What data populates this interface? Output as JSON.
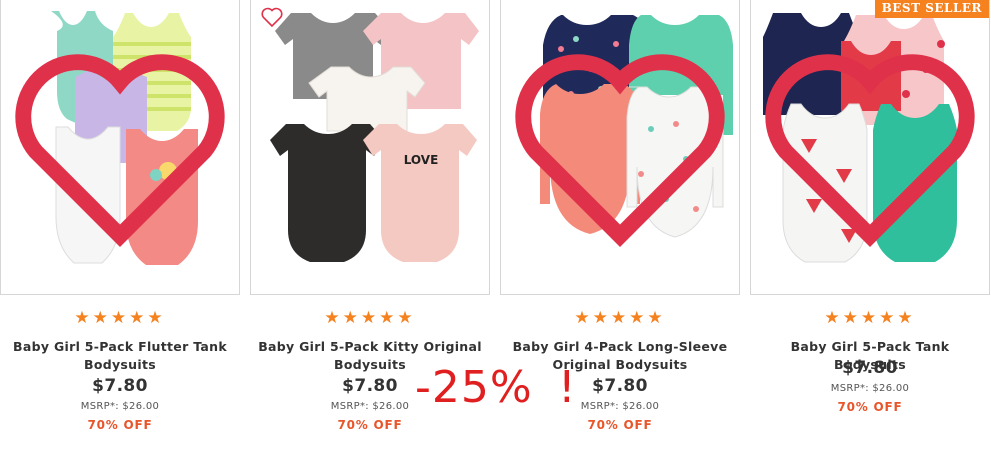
{
  "products": [
    {
      "name": "Baby Girl 5-Pack Flutter Tank Bodysuits",
      "rating": 5,
      "price": "$7.80",
      "msrp": "MSRP*: $26.00",
      "discount": "70% OFF",
      "badge": "",
      "image": "flutter-tank-bodysuits-pack"
    },
    {
      "name": "Baby Girl 5-Pack Kitty Original Bodysuits",
      "rating": 5,
      "price": "$7.80",
      "msrp": "MSRP*: $26.00",
      "discount": "70% OFF",
      "badge": "",
      "image": "kitty-bodysuits-pack",
      "print_text": "LOVE"
    },
    {
      "name": "Baby Girl 4-Pack Long-Sleeve Original Bodysuits",
      "rating": 5,
      "price": "$7.80",
      "msrp": "MSRP*: $26.00",
      "discount": "70% OFF",
      "badge": "",
      "image": "long-sleeve-bodysuits-pack"
    },
    {
      "name": "Baby Girl 5-Pack Tank Bodysuits",
      "rating": 5,
      "price": "$7.80",
      "msrp": "MSRP*: $26.00",
      "discount": "70% OFF",
      "badge": "BEST SELLER",
      "image": "tank-bodysuits-pack"
    }
  ],
  "stars_text": "★★★★★",
  "overlay": {
    "text": "-25%",
    "mark": "!"
  },
  "colors": {
    "accent": "#f5821f",
    "discount": "#e8552a",
    "overlay": "#e02020",
    "border": "#d6d6d6"
  }
}
